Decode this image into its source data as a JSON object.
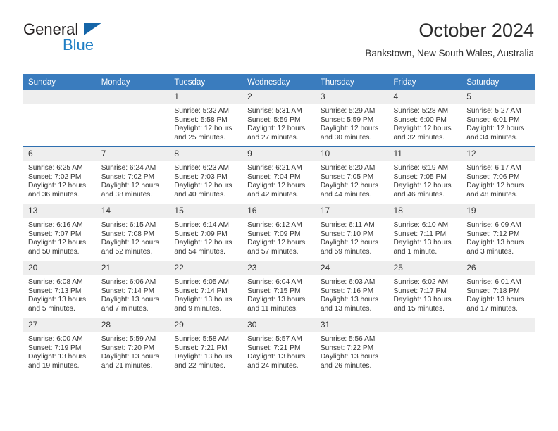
{
  "branding": {
    "name_dark": "General",
    "name_blue": "Blue",
    "triangle_color": "#1565a8",
    "blue_color": "#1f7ec4"
  },
  "header": {
    "month_title": "October 2024",
    "location": "Bankstown, New South Wales, Australia"
  },
  "theme": {
    "header_blue": "#3a7cbe",
    "row_rule_blue": "#2f6fb0",
    "daynum_band": "#eeeeee"
  },
  "calendar": {
    "weekday_headers": [
      "Sunday",
      "Monday",
      "Tuesday",
      "Wednesday",
      "Thursday",
      "Friday",
      "Saturday"
    ],
    "weeks": [
      [
        {
          "day": "",
          "sunrise": "",
          "sunset": "",
          "daylight": ""
        },
        {
          "day": "",
          "sunrise": "",
          "sunset": "",
          "daylight": ""
        },
        {
          "day": "1",
          "sunrise": "Sunrise: 5:32 AM",
          "sunset": "Sunset: 5:58 PM",
          "daylight": "Daylight: 12 hours and 25 minutes."
        },
        {
          "day": "2",
          "sunrise": "Sunrise: 5:31 AM",
          "sunset": "Sunset: 5:59 PM",
          "daylight": "Daylight: 12 hours and 27 minutes."
        },
        {
          "day": "3",
          "sunrise": "Sunrise: 5:29 AM",
          "sunset": "Sunset: 5:59 PM",
          "daylight": "Daylight: 12 hours and 30 minutes."
        },
        {
          "day": "4",
          "sunrise": "Sunrise: 5:28 AM",
          "sunset": "Sunset: 6:00 PM",
          "daylight": "Daylight: 12 hours and 32 minutes."
        },
        {
          "day": "5",
          "sunrise": "Sunrise: 5:27 AM",
          "sunset": "Sunset: 6:01 PM",
          "daylight": "Daylight: 12 hours and 34 minutes."
        }
      ],
      [
        {
          "day": "6",
          "sunrise": "Sunrise: 6:25 AM",
          "sunset": "Sunset: 7:02 PM",
          "daylight": "Daylight: 12 hours and 36 minutes."
        },
        {
          "day": "7",
          "sunrise": "Sunrise: 6:24 AM",
          "sunset": "Sunset: 7:02 PM",
          "daylight": "Daylight: 12 hours and 38 minutes."
        },
        {
          "day": "8",
          "sunrise": "Sunrise: 6:23 AM",
          "sunset": "Sunset: 7:03 PM",
          "daylight": "Daylight: 12 hours and 40 minutes."
        },
        {
          "day": "9",
          "sunrise": "Sunrise: 6:21 AM",
          "sunset": "Sunset: 7:04 PM",
          "daylight": "Daylight: 12 hours and 42 minutes."
        },
        {
          "day": "10",
          "sunrise": "Sunrise: 6:20 AM",
          "sunset": "Sunset: 7:05 PM",
          "daylight": "Daylight: 12 hours and 44 minutes."
        },
        {
          "day": "11",
          "sunrise": "Sunrise: 6:19 AM",
          "sunset": "Sunset: 7:05 PM",
          "daylight": "Daylight: 12 hours and 46 minutes."
        },
        {
          "day": "12",
          "sunrise": "Sunrise: 6:17 AM",
          "sunset": "Sunset: 7:06 PM",
          "daylight": "Daylight: 12 hours and 48 minutes."
        }
      ],
      [
        {
          "day": "13",
          "sunrise": "Sunrise: 6:16 AM",
          "sunset": "Sunset: 7:07 PM",
          "daylight": "Daylight: 12 hours and 50 minutes."
        },
        {
          "day": "14",
          "sunrise": "Sunrise: 6:15 AM",
          "sunset": "Sunset: 7:08 PM",
          "daylight": "Daylight: 12 hours and 52 minutes."
        },
        {
          "day": "15",
          "sunrise": "Sunrise: 6:14 AM",
          "sunset": "Sunset: 7:09 PM",
          "daylight": "Daylight: 12 hours and 54 minutes."
        },
        {
          "day": "16",
          "sunrise": "Sunrise: 6:12 AM",
          "sunset": "Sunset: 7:09 PM",
          "daylight": "Daylight: 12 hours and 57 minutes."
        },
        {
          "day": "17",
          "sunrise": "Sunrise: 6:11 AM",
          "sunset": "Sunset: 7:10 PM",
          "daylight": "Daylight: 12 hours and 59 minutes."
        },
        {
          "day": "18",
          "sunrise": "Sunrise: 6:10 AM",
          "sunset": "Sunset: 7:11 PM",
          "daylight": "Daylight: 13 hours and 1 minute."
        },
        {
          "day": "19",
          "sunrise": "Sunrise: 6:09 AM",
          "sunset": "Sunset: 7:12 PM",
          "daylight": "Daylight: 13 hours and 3 minutes."
        }
      ],
      [
        {
          "day": "20",
          "sunrise": "Sunrise: 6:08 AM",
          "sunset": "Sunset: 7:13 PM",
          "daylight": "Daylight: 13 hours and 5 minutes."
        },
        {
          "day": "21",
          "sunrise": "Sunrise: 6:06 AM",
          "sunset": "Sunset: 7:14 PM",
          "daylight": "Daylight: 13 hours and 7 minutes."
        },
        {
          "day": "22",
          "sunrise": "Sunrise: 6:05 AM",
          "sunset": "Sunset: 7:14 PM",
          "daylight": "Daylight: 13 hours and 9 minutes."
        },
        {
          "day": "23",
          "sunrise": "Sunrise: 6:04 AM",
          "sunset": "Sunset: 7:15 PM",
          "daylight": "Daylight: 13 hours and 11 minutes."
        },
        {
          "day": "24",
          "sunrise": "Sunrise: 6:03 AM",
          "sunset": "Sunset: 7:16 PM",
          "daylight": "Daylight: 13 hours and 13 minutes."
        },
        {
          "day": "25",
          "sunrise": "Sunrise: 6:02 AM",
          "sunset": "Sunset: 7:17 PM",
          "daylight": "Daylight: 13 hours and 15 minutes."
        },
        {
          "day": "26",
          "sunrise": "Sunrise: 6:01 AM",
          "sunset": "Sunset: 7:18 PM",
          "daylight": "Daylight: 13 hours and 17 minutes."
        }
      ],
      [
        {
          "day": "27",
          "sunrise": "Sunrise: 6:00 AM",
          "sunset": "Sunset: 7:19 PM",
          "daylight": "Daylight: 13 hours and 19 minutes."
        },
        {
          "day": "28",
          "sunrise": "Sunrise: 5:59 AM",
          "sunset": "Sunset: 7:20 PM",
          "daylight": "Daylight: 13 hours and 21 minutes."
        },
        {
          "day": "29",
          "sunrise": "Sunrise: 5:58 AM",
          "sunset": "Sunset: 7:21 PM",
          "daylight": "Daylight: 13 hours and 22 minutes."
        },
        {
          "day": "30",
          "sunrise": "Sunrise: 5:57 AM",
          "sunset": "Sunset: 7:21 PM",
          "daylight": "Daylight: 13 hours and 24 minutes."
        },
        {
          "day": "31",
          "sunrise": "Sunrise: 5:56 AM",
          "sunset": "Sunset: 7:22 PM",
          "daylight": "Daylight: 13 hours and 26 minutes."
        },
        {
          "day": "",
          "sunrise": "",
          "sunset": "",
          "daylight": ""
        },
        {
          "day": "",
          "sunrise": "",
          "sunset": "",
          "daylight": ""
        }
      ]
    ]
  }
}
